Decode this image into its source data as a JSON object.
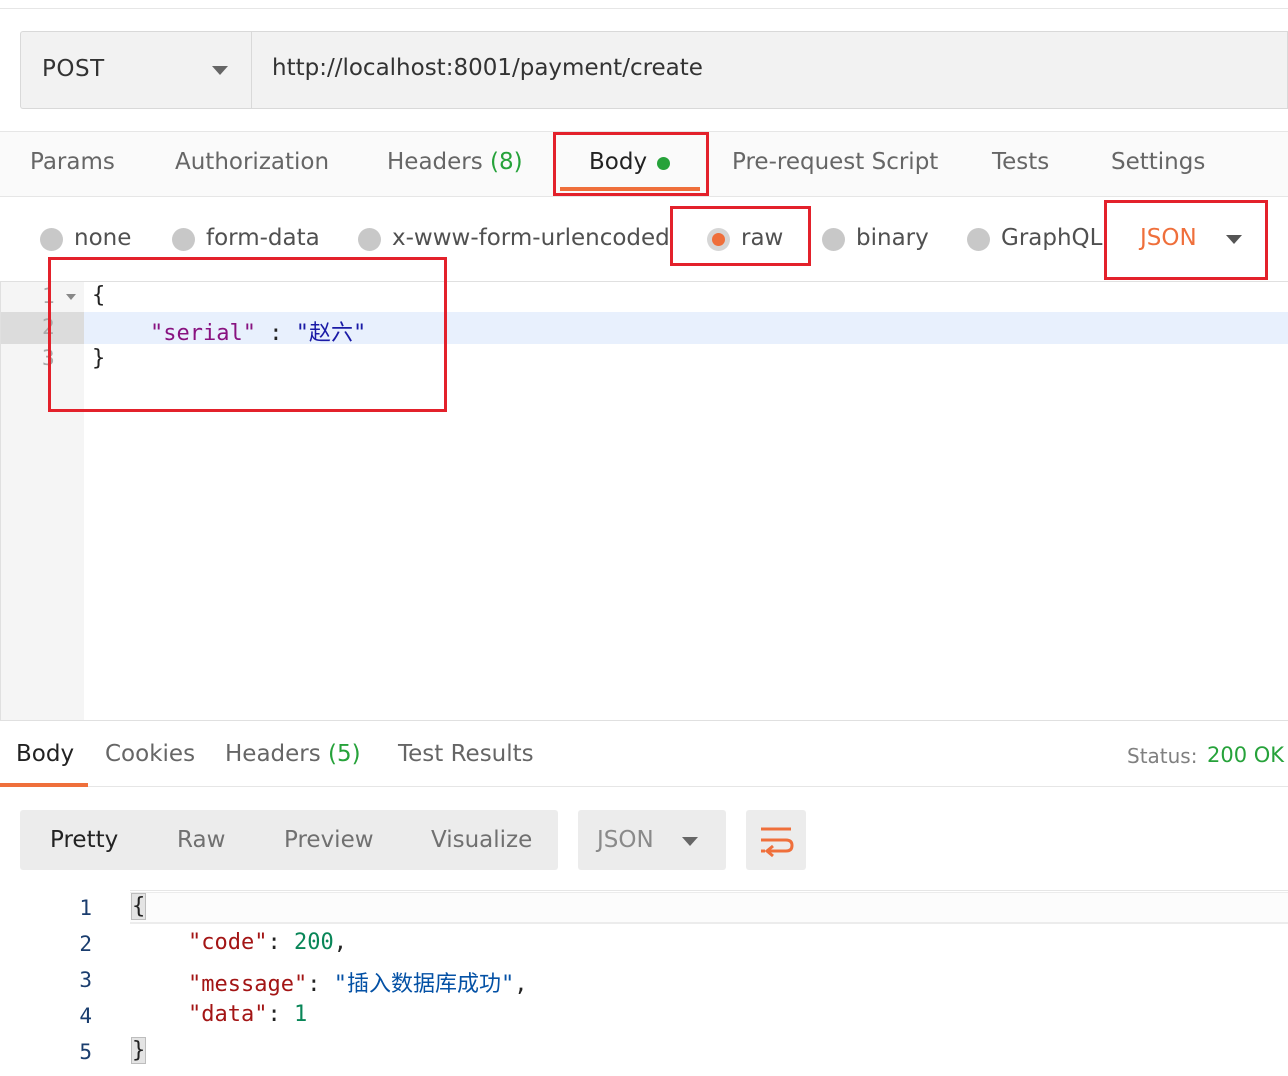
{
  "request": {
    "method": "POST",
    "url": "http://localhost:8001/payment/create"
  },
  "request_tabs": {
    "params": "Params",
    "authorization": "Authorization",
    "headers_label": "Headers",
    "headers_count": "(8)",
    "body": "Body",
    "pre_request_script": "Pre-request Script",
    "tests": "Tests",
    "settings": "Settings",
    "active": "Body"
  },
  "body_types": {
    "none": "none",
    "form_data": "form-data",
    "urlencoded": "x-www-form-urlencoded",
    "raw": "raw",
    "binary": "binary",
    "graphql": "GraphQL",
    "selected": "raw",
    "language": "JSON"
  },
  "editor": {
    "line_numbers": [
      "1",
      "2",
      "3"
    ],
    "line1": "{",
    "line2_key": "\"serial\"",
    "line2_sep": " : ",
    "line2_value": "\"赵六\"",
    "line3": "}"
  },
  "response_tabs": {
    "body": "Body",
    "cookies": "Cookies",
    "headers_label": "Headers",
    "headers_count": "(5)",
    "test_results": "Test Results",
    "status_label": "Status:",
    "status_value": "200 OK"
  },
  "response_view": {
    "pretty": "Pretty",
    "raw": "Raw",
    "preview": "Preview",
    "visualize": "Visualize",
    "language": "JSON",
    "wrap_icon": "wrap-lines-icon"
  },
  "response_body": {
    "line_numbers": [
      "1",
      "2",
      "3",
      "4",
      "5"
    ],
    "open": "{",
    "code_key": "\"code\"",
    "code_value": "200",
    "message_key": "\"message\"",
    "message_value": "\"插入数据库成功\"",
    "data_key": "\"data\"",
    "data_value": "1",
    "close": "}"
  },
  "colors": {
    "accent": "#ef6f3b",
    "success": "#26a23a",
    "highlight_box": "#e3212b"
  }
}
